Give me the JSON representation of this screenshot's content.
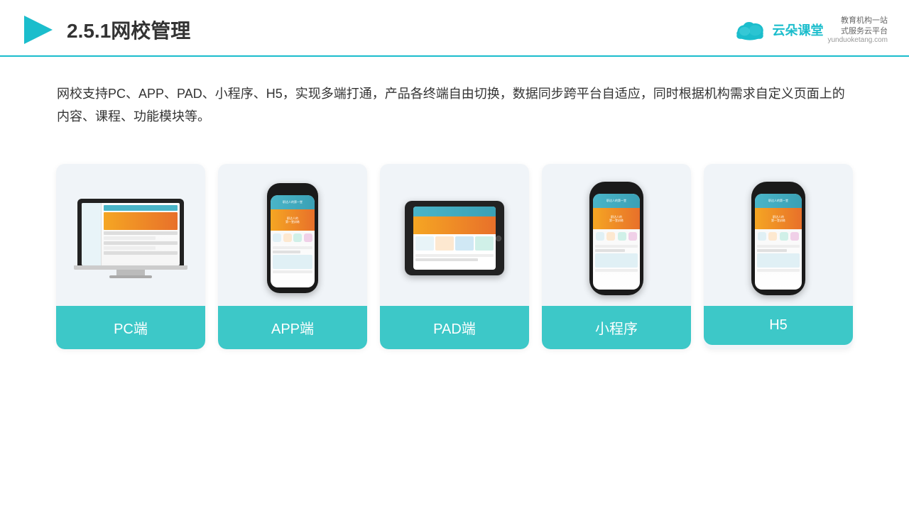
{
  "header": {
    "title": "2.5.1网校管理",
    "logo_name": "云朵课堂",
    "logo_url": "yunduoketang.com",
    "logo_tagline_line1": "教育机构一站",
    "logo_tagline_line2": "式服务云平台"
  },
  "description": {
    "text": "网校支持PC、APP、PAD、小程序、H5，实现多端打通，产品各终端自由切换，数据同步跨平台自适应，同时根据机构需求自定义页面上的内容、课程、功能模块等。"
  },
  "cards": [
    {
      "label": "PC端",
      "type": "pc"
    },
    {
      "label": "APP端",
      "type": "phone"
    },
    {
      "label": "PAD端",
      "type": "pad"
    },
    {
      "label": "小程序",
      "type": "phone2"
    },
    {
      "label": "H5",
      "type": "phone3"
    }
  ]
}
